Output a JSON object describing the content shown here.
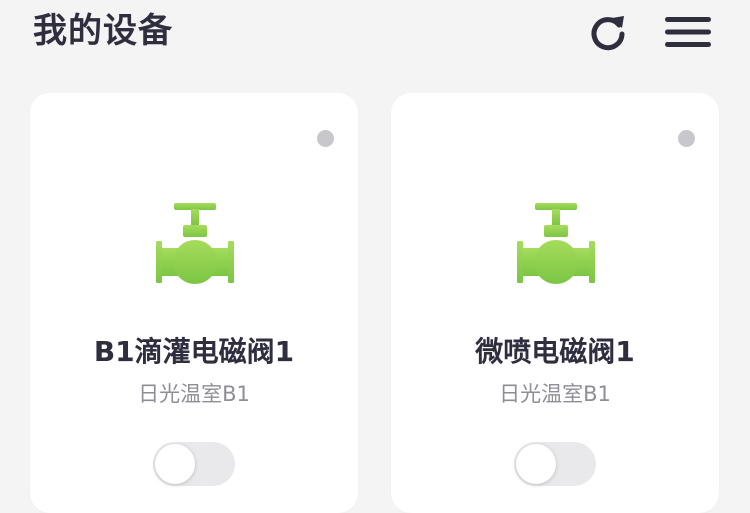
{
  "header": {
    "title": "我的设备",
    "refresh_icon": "refresh-icon",
    "menu_icon": "menu-icon"
  },
  "devices": [
    {
      "name": "B1滴灌电磁阀1",
      "location": "日光温室B1",
      "icon": "valve-icon",
      "online": false,
      "switch_on": false
    },
    {
      "name": "微喷电磁阀1",
      "location": "日光温室B1",
      "icon": "valve-icon",
      "online": false,
      "switch_on": false
    }
  ],
  "colors": {
    "title": "#2f2e3f",
    "valve_green": "#8fd14f",
    "status_offline": "#c8c8cc",
    "toggle_off": "#e9e9ec"
  }
}
